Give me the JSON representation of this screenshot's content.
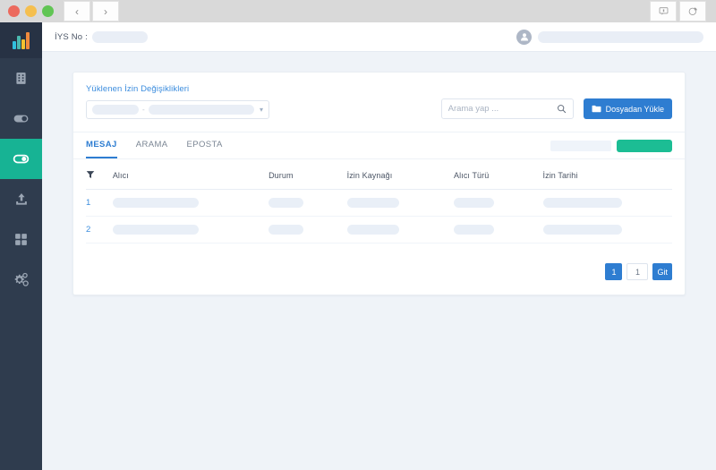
{
  "window": {
    "traffic_lights": [
      "close",
      "minimize",
      "maximize"
    ],
    "nav_back": "‹",
    "nav_forward": "›",
    "chrome_buttons": [
      "comment-icon",
      "pie-chart-icon"
    ]
  },
  "sidebar": {
    "logo": "bar-chart-logo",
    "items": [
      {
        "name": "sidebar-item-company",
        "icon": "building-icon",
        "active": false
      },
      {
        "name": "sidebar-item-toggle",
        "icon": "toggle-off-icon",
        "active": false
      },
      {
        "name": "sidebar-item-consents",
        "icon": "toggle-on-icon",
        "active": true
      },
      {
        "name": "sidebar-item-upload",
        "icon": "upload-icon",
        "active": false
      },
      {
        "name": "sidebar-item-apps",
        "icon": "grid-icon",
        "active": false
      },
      {
        "name": "sidebar-item-settings",
        "icon": "gears-icon",
        "active": false
      }
    ]
  },
  "topbar": {
    "iys_label": "İYS No :",
    "iys_value": "",
    "user_name": ""
  },
  "card": {
    "filter_label": "Yüklenen İzin Değişiklikleri",
    "select_value": "",
    "select_separator": "-",
    "search": {
      "placeholder": "Arama yap ...",
      "value": "",
      "icon": "search-icon"
    },
    "upload_button": {
      "label": "Dosyadan Yükle",
      "icon": "folder-icon",
      "color": "#2e7dd1"
    },
    "tabs": [
      {
        "label": "MESAJ",
        "active": true
      },
      {
        "label": "ARAMA",
        "active": false
      },
      {
        "label": "EPOSTA",
        "active": false
      }
    ],
    "tab_actions": {
      "ghost_label": "",
      "green_label": "",
      "green_color": "#1cbd94"
    },
    "table": {
      "filter_icon": "funnel-icon",
      "columns": [
        "Alıcı",
        "Durum",
        "İzin Kaynağı",
        "Alıcı Türü",
        "İzin Tarihi"
      ],
      "rows": [
        {
          "index": "1",
          "alici": "",
          "durum": "",
          "izin_kaynagi": "",
          "alici_turu": "",
          "izin_tarihi": ""
        },
        {
          "index": "2",
          "alici": "",
          "durum": "",
          "izin_kaynagi": "",
          "alici_turu": "",
          "izin_tarihi": ""
        }
      ]
    },
    "pagination": {
      "current_page": "1",
      "page_input_value": "1",
      "go_label": "Git"
    }
  },
  "colors": {
    "sidebar_bg": "#2f3c4e",
    "sidebar_active": "#17b394",
    "accent_blue": "#2e7dd1",
    "page_bg": "#eff3f8"
  }
}
